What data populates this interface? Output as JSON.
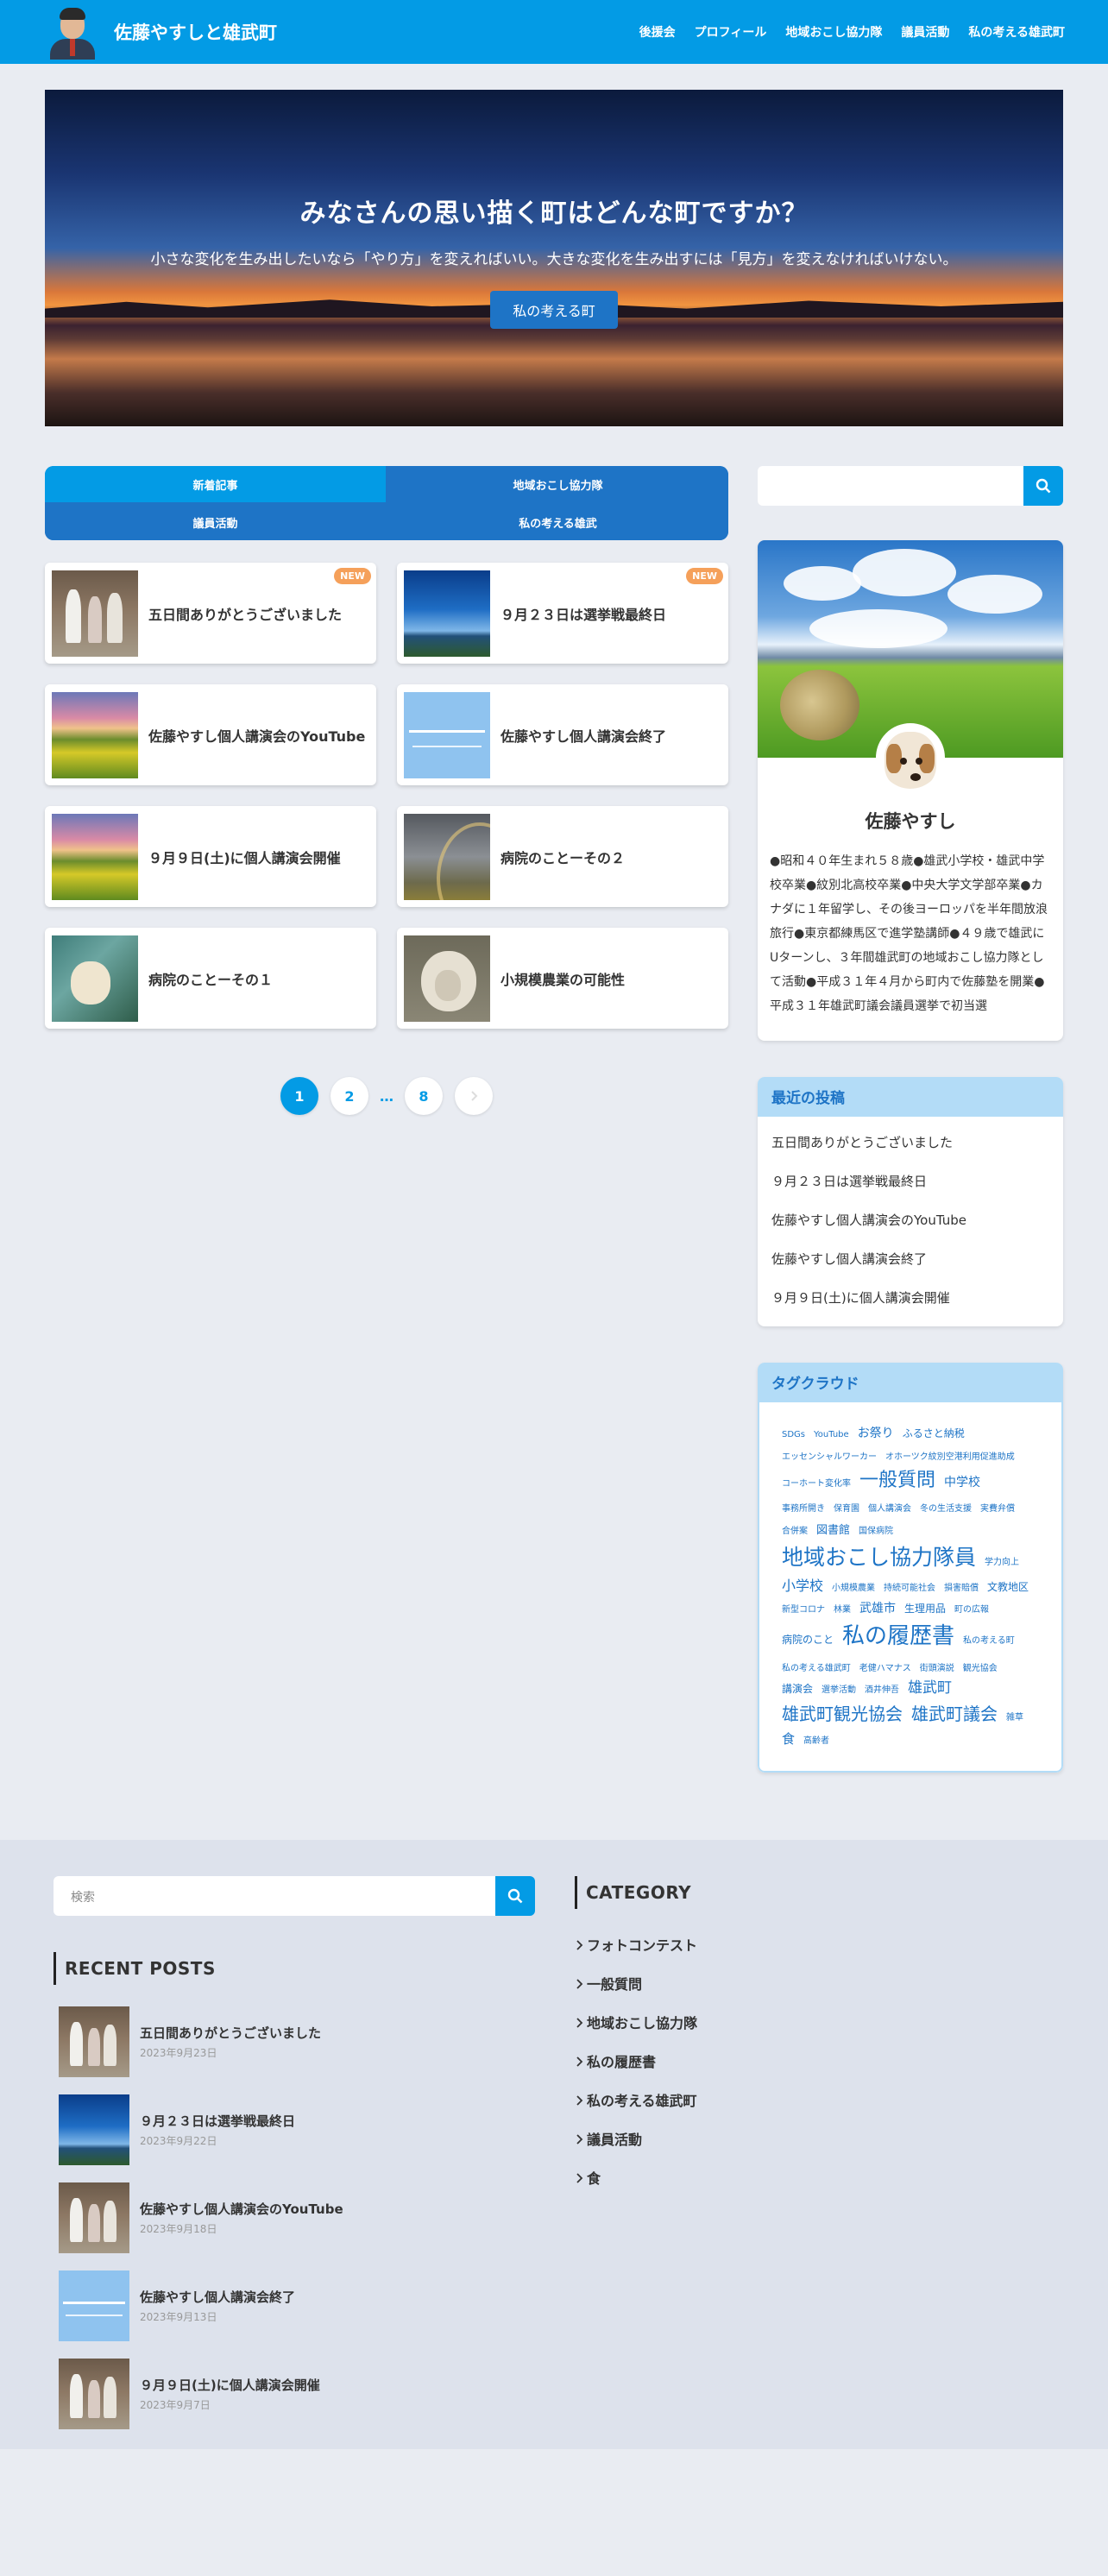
{
  "header": {
    "site_title": "佐藤やすしと雄武町",
    "nav": [
      "後援会",
      "プロフィール",
      "地域おこし協力隊",
      "議員活動",
      "私の考える雄武町"
    ]
  },
  "hero": {
    "title": "みなさんの思い描く町はどんな町ですか？",
    "subtitle": "小さな変化を生み出したいなら「やり方」を変えればいい。大きな変化を生み出すには「見方」を変えなければいけない。",
    "button": "私の考える町"
  },
  "tabs": [
    "新着記事",
    "地域おこし協力隊",
    "議員活動",
    "私の考える雄武"
  ],
  "posts": [
    {
      "title": "五日間ありがとうございました",
      "badge": "NEW",
      "thumb": "people"
    },
    {
      "title": "９月２３日は選挙戦最終日",
      "badge": "NEW",
      "thumb": "sky"
    },
    {
      "title": "佐藤やすし個人講演会のYouTube",
      "badge": "",
      "thumb": "flowers"
    },
    {
      "title": "佐藤やすし個人講演会終了",
      "badge": "",
      "thumb": "doc"
    },
    {
      "title": "９月９日(土)に個人講演会開催",
      "badge": "",
      "thumb": "flowers"
    },
    {
      "title": "病院のことーその２",
      "badge": "",
      "thumb": "rainbow"
    },
    {
      "title": "病院のことーその１",
      "badge": "",
      "thumb": "dog"
    },
    {
      "title": "小規模農業の可能性",
      "badge": "",
      "thumb": "sheep"
    }
  ],
  "pagination": {
    "current": "1",
    "p2": "2",
    "dots": "…",
    "last": "8",
    "next": ""
  },
  "profile": {
    "name": "佐藤やすし",
    "bio": "●昭和４０年生まれ５８歳●雄武小学校・雄武中学校卒業●紋別北高校卒業●中央大学文学部卒業●カナダに１年留学し、その後ヨーロッパを半年間放浪旅行●東京都練馬区で進学塾講師●４９歳で雄武にUターンし、３年間雄武町の地域おこし協力隊として活動●平成３１年４月から町内で佐藤塾を開業●平成３１年雄武町議会議員選挙で初当選"
  },
  "recent_widget": {
    "title": "最近の投稿",
    "items": [
      "五日間ありがとうございました",
      "９月２３日は選挙戦最終日",
      "佐藤やすし個人講演会のYouTube",
      "佐藤やすし個人講演会終了",
      "９月９日(土)に個人講演会開催"
    ]
  },
  "tag_widget": {
    "title": "タグクラウド",
    "tags": [
      {
        "t": "SDGs",
        "s": 10
      },
      {
        "t": "YouTube",
        "s": 10
      },
      {
        "t": "お祭り",
        "s": 14
      },
      {
        "t": "ふるさと納税",
        "s": 12
      },
      {
        "t": "エッセンシャルワーカー",
        "s": 10
      },
      {
        "t": "オホーツク紋別空港利用促進助成",
        "s": 10
      },
      {
        "t": "コーホート変化率",
        "s": 10
      },
      {
        "t": "一般質問",
        "s": 22
      },
      {
        "t": "中学校",
        "s": 14
      },
      {
        "t": "事務所開き",
        "s": 10
      },
      {
        "t": "保育園",
        "s": 10
      },
      {
        "t": "個人講演会",
        "s": 10
      },
      {
        "t": "冬の生活支援",
        "s": 10
      },
      {
        "t": "実費弁償",
        "s": 10
      },
      {
        "t": "合併案",
        "s": 10
      },
      {
        "t": "図書館",
        "s": 13
      },
      {
        "t": "国保病院",
        "s": 10
      },
      {
        "t": "地域おこし協力隊員",
        "s": 25
      },
      {
        "t": "学力向上",
        "s": 10
      },
      {
        "t": "小学校",
        "s": 16
      },
      {
        "t": "小規模農業",
        "s": 10
      },
      {
        "t": "持続可能社会",
        "s": 10
      },
      {
        "t": "損害賠償",
        "s": 10
      },
      {
        "t": "文教地区",
        "s": 12
      },
      {
        "t": "新型コロナ",
        "s": 10
      },
      {
        "t": "林業",
        "s": 10
      },
      {
        "t": "武雄市",
        "s": 14
      },
      {
        "t": "生理用品",
        "s": 12
      },
      {
        "t": "町の広報",
        "s": 10
      },
      {
        "t": "病院のこと",
        "s": 12
      },
      {
        "t": "私の履歴書",
        "s": 26
      },
      {
        "t": "私の考える町",
        "s": 10
      },
      {
        "t": "私の考える雄武町",
        "s": 10
      },
      {
        "t": "老健ハマナス",
        "s": 10
      },
      {
        "t": "街頭演説",
        "s": 10
      },
      {
        "t": "観光協会",
        "s": 10
      },
      {
        "t": "講演会",
        "s": 12
      },
      {
        "t": "選挙活動",
        "s": 10
      },
      {
        "t": "酒井伸吾",
        "s": 10
      },
      {
        "t": "雄武町",
        "s": 17
      },
      {
        "t": "雄武町観光協会",
        "s": 20
      },
      {
        "t": "雄武町議会",
        "s": 20
      },
      {
        "t": "雑草",
        "s": 10
      },
      {
        "t": "食",
        "s": 15
      },
      {
        "t": "高齢者",
        "s": 10
      }
    ]
  },
  "footer": {
    "search_placeholder": "検索",
    "recent_title": "RECENT POSTS",
    "recent_posts": [
      {
        "title": "五日間ありがとうございました",
        "date": "2023年9月23日",
        "thumb": "people"
      },
      {
        "title": "９月２３日は選挙戦最終日",
        "date": "2023年9月22日",
        "thumb": "sky"
      },
      {
        "title": "佐藤やすし個人講演会のYouTube",
        "date": "2023年9月18日",
        "thumb": "people"
      },
      {
        "title": "佐藤やすし個人講演会終了",
        "date": "2023年9月13日",
        "thumb": "doc"
      },
      {
        "title": "９月９日(土)に個人講演会開催",
        "date": "2023年9月7日",
        "thumb": "people"
      }
    ],
    "category_title": "CATEGORY",
    "categories": [
      "フォトコンテスト",
      "一般質問",
      "地域おこし協力隊",
      "私の履歴書",
      "私の考える雄武町",
      "議員活動",
      "食"
    ]
  },
  "colors": {
    "primary": "#039be5",
    "accent": "#1e74c6",
    "badge": "#f5a05a",
    "tag_header": "#b3dcf7"
  },
  "icons": {
    "search": "search-icon",
    "chevron": "chevron-right-icon"
  }
}
